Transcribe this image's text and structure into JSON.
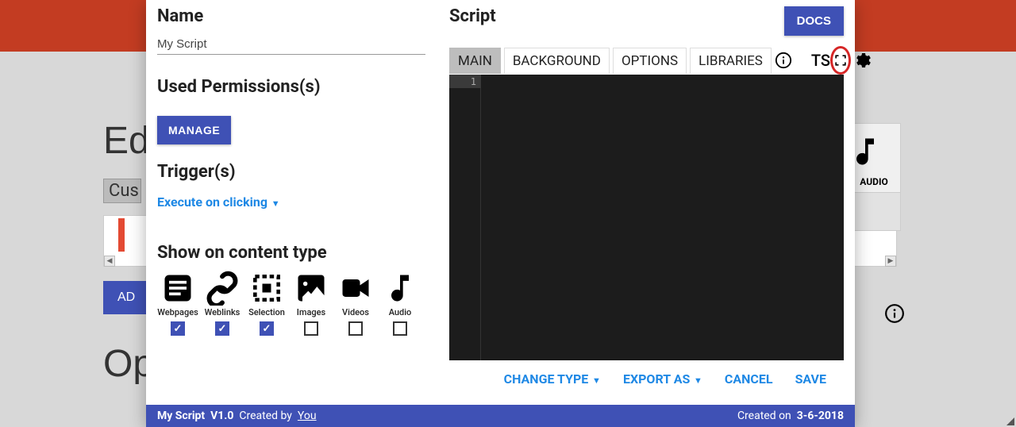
{
  "background": {
    "edit_heading": "Ed",
    "custom_label": "Cus",
    "add_button": "AD",
    "options_heading": "Op",
    "audio_card_label": "AUDIO"
  },
  "modal": {
    "name_label": "Name",
    "name_value": "My Script",
    "permissions_label": "Used Permissions(s)",
    "manage_button": "MANAGE",
    "triggers_label": "Trigger(s)",
    "trigger_link": "Execute on clicking",
    "content_type_label": "Show on content type",
    "content_types": [
      {
        "key": "webpages",
        "label": "Webpages",
        "checked": true
      },
      {
        "key": "weblinks",
        "label": "Weblinks",
        "checked": true
      },
      {
        "key": "selection",
        "label": "Selection",
        "checked": true
      },
      {
        "key": "images",
        "label": "Images",
        "checked": false
      },
      {
        "key": "videos",
        "label": "Videos",
        "checked": false
      },
      {
        "key": "audio",
        "label": "Audio",
        "checked": false
      }
    ],
    "script_label": "Script",
    "docs_button": "DOCS",
    "tabs": {
      "main": "MAIN",
      "background": "BACKGROUND",
      "options": "OPTIONS",
      "libraries": "LIBRARIES",
      "ts": "TS"
    },
    "editor_line_number": "1",
    "actions": {
      "change_type": "CHANGE TYPE",
      "export_as": "EXPORT AS",
      "cancel": "CANCEL",
      "save": "SAVE"
    },
    "footer": {
      "script_name": "My Script",
      "version": "V1.0",
      "created_by_label": "Created by",
      "author": "You",
      "created_on_label": "Created on",
      "created_date": "3-6-2018"
    }
  }
}
